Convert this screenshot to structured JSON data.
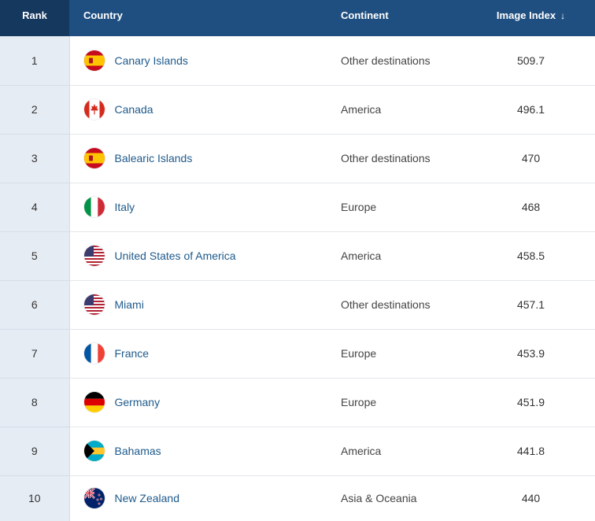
{
  "header": {
    "rank": "Rank",
    "country": "Country",
    "continent": "Continent",
    "image_index": "Image Index",
    "sort_icon": "arrow-down-icon"
  },
  "rows": [
    {
      "rank": "1",
      "country": "Canary Islands",
      "flag": "spain-flag-icon",
      "continent": "Other destinations",
      "index": "509.7"
    },
    {
      "rank": "2",
      "country": "Canada",
      "flag": "canada-flag-icon",
      "continent": "America",
      "index": "496.1"
    },
    {
      "rank": "3",
      "country": "Balearic Islands",
      "flag": "spain-flag-icon",
      "continent": "Other destinations",
      "index": "470"
    },
    {
      "rank": "4",
      "country": "Italy",
      "flag": "italy-flag-icon",
      "continent": "Europe",
      "index": "468"
    },
    {
      "rank": "5",
      "country": "United States of America",
      "flag": "usa-flag-icon",
      "continent": "America",
      "index": "458.5"
    },
    {
      "rank": "6",
      "country": "Miami",
      "flag": "usa-flag-icon",
      "continent": "Other destinations",
      "index": "457.1"
    },
    {
      "rank": "7",
      "country": "France",
      "flag": "france-flag-icon",
      "continent": "Europe",
      "index": "453.9"
    },
    {
      "rank": "8",
      "country": "Germany",
      "flag": "germany-flag-icon",
      "continent": "Europe",
      "index": "451.9"
    },
    {
      "rank": "9",
      "country": "Bahamas",
      "flag": "bahamas-flag-icon",
      "continent": "America",
      "index": "441.8"
    },
    {
      "rank": "10",
      "country": "New Zealand",
      "flag": "new-zealand-flag-icon",
      "continent": "Asia & Oceania",
      "index": "440"
    }
  ],
  "colors": {
    "header_bg": "#1f4f80",
    "rank_header_bg": "#15385f",
    "rank_col_bg": "#e6ecf4",
    "link": "#1e5a8c"
  }
}
